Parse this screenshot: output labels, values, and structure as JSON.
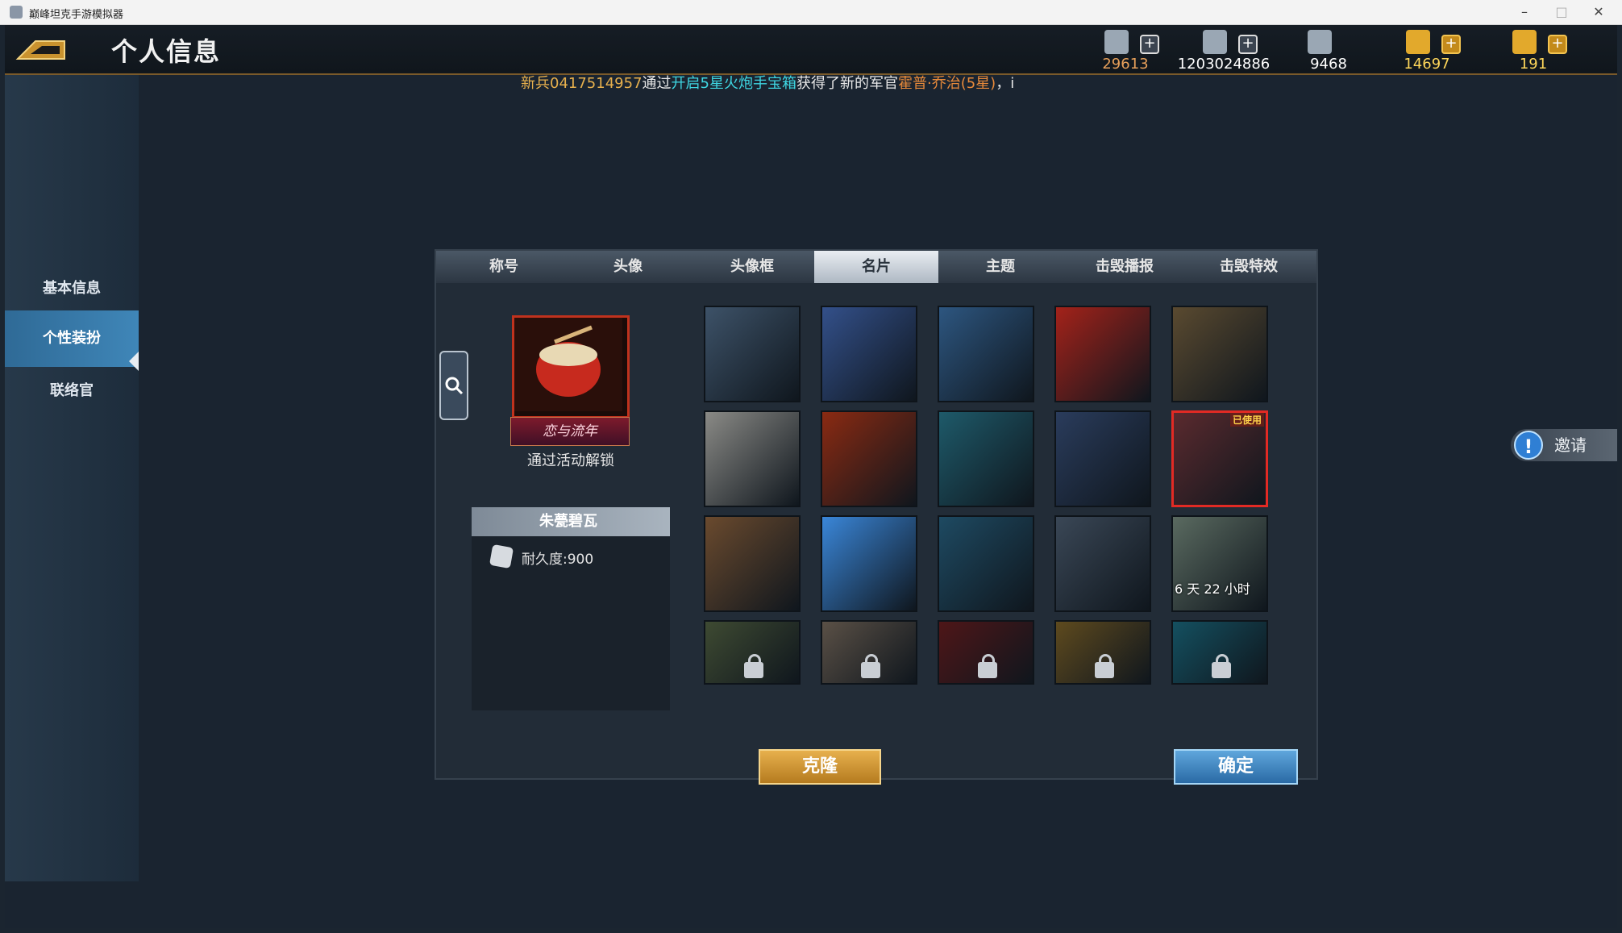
{
  "window": {
    "title": "巅峰坦克手游模拟器",
    "minimize": "–",
    "maximize": "□",
    "close": "✕"
  },
  "header": {
    "title": "个人信息",
    "resources": [
      {
        "icon": "medal-icon",
        "value": "29613",
        "color": "#e7a05a",
        "addable": true,
        "gold": false
      },
      {
        "icon": "cash-icon",
        "value": "1203024886",
        "color": "#ffffff",
        "addable": true,
        "gold": false
      },
      {
        "icon": "oil-barrel-icon",
        "value": "9468",
        "color": "#ffffff",
        "addable": false,
        "gold": false
      },
      {
        "icon": "gold-bars-icon",
        "value": "14697",
        "color": "#ffd75a",
        "addable": true,
        "gold": true
      },
      {
        "icon": "rocket-icon",
        "value": "191",
        "color": "#ffd75a",
        "addable": true,
        "gold": true
      }
    ]
  },
  "ticker": {
    "p1": "新兵0417514957",
    "p2": "通过",
    "p3": "开启5星火炮手宝箱",
    "p4": "获得了新的军官",
    "p5": "霍普·乔治(5星)",
    "p6": "，i"
  },
  "sidebar": {
    "items": [
      {
        "label": "基本信息"
      },
      {
        "label": "个性装扮"
      },
      {
        "label": "联络官"
      }
    ],
    "active": 1
  },
  "tabs": [
    {
      "label": "称号"
    },
    {
      "label": "头像"
    },
    {
      "label": "头像框"
    },
    {
      "label": "名片"
    },
    {
      "label": "主题"
    },
    {
      "label": "击毁播报"
    },
    {
      "label": "击毁特效"
    }
  ],
  "active_tab": 3,
  "preview": {
    "banner": "恋与流年",
    "unlock_text": "通过活动解锁",
    "name": "朱甍碧瓦",
    "durability": "耐久度:900"
  },
  "cards": [
    {
      "name": "card-steel-pattern",
      "color": "#3d5268",
      "locked": false
    },
    {
      "name": "card-blue-star",
      "color": "#33508a",
      "locked": false
    },
    {
      "name": "card-tank-silhouette",
      "color": "#2d5680",
      "locked": false
    },
    {
      "name": "card-red-flag",
      "color": "#a3221a",
      "locked": false
    },
    {
      "name": "card-gold-stars",
      "color": "#5a4a30",
      "locked": false
    },
    {
      "name": "card-metal-plate",
      "color": "#8a8a86",
      "locked": false
    },
    {
      "name": "card-flame",
      "color": "#8a2a12",
      "locked": false
    },
    {
      "name": "card-hexagon",
      "color": "#1e5a6a",
      "locked": false
    },
    {
      "name": "card-blue-geometric",
      "color": "#2a3c5c",
      "locked": false
    },
    {
      "name": "card-red-swirl",
      "color": "#5a2a2e",
      "locked": false,
      "used": "已使用"
    },
    {
      "name": "card-brown-floral",
      "color": "#6a4a2e",
      "locked": false
    },
    {
      "name": "card-blue-diamond",
      "color": "#3a86d8",
      "locked": false
    },
    {
      "name": "card-teal-pattern",
      "color": "#1e4a62",
      "locked": false
    },
    {
      "name": "card-gray-books",
      "color": "#3a4756",
      "locked": false
    },
    {
      "name": "card-landscape",
      "color": "#5a6a60",
      "locked": false,
      "timer": "6 天 22 小时"
    },
    {
      "name": "card-camo",
      "color": "#3e4a32",
      "locked": true
    },
    {
      "name": "card-stripes",
      "color": "#5a5046",
      "locked": true
    },
    {
      "name": "card-dark-red",
      "color": "#4e1618",
      "locked": true
    },
    {
      "name": "card-dark-gold",
      "color": "#5e4a1e",
      "locked": true
    },
    {
      "name": "card-ocean",
      "color": "#145060",
      "locked": true
    }
  ],
  "buttons": {
    "clone": "克隆",
    "confirm": "确定"
  },
  "invite": {
    "label": "邀请",
    "icon_text": "!"
  }
}
